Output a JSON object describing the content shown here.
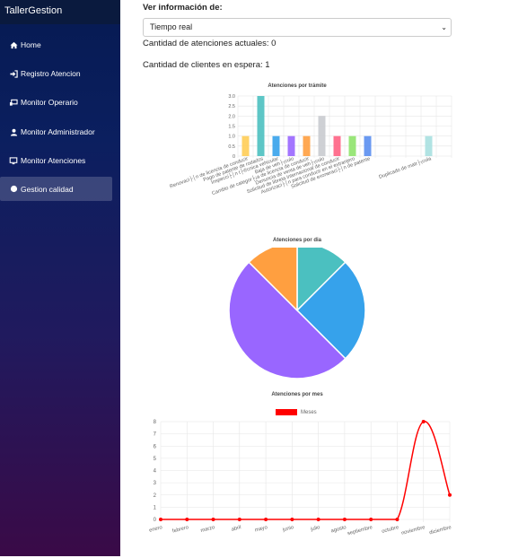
{
  "app": {
    "title": "TallerGestion"
  },
  "sidebar": {
    "items": [
      {
        "label": "Home",
        "icon": "home-icon"
      },
      {
        "label": "Registro Atencion",
        "icon": "sign-in-icon"
      },
      {
        "label": "Monitor Operario",
        "icon": "desktop-icon"
      },
      {
        "label": "Monitor Administrador",
        "icon": "user-icon"
      },
      {
        "label": "Monitor Atenciones",
        "icon": "monitor-icon"
      },
      {
        "label": "Gestion calidad",
        "icon": "circle-icon",
        "active": true
      }
    ]
  },
  "main": {
    "ver_label": "Ver información de:",
    "select_value": "Tiempo real",
    "atenciones_actuales": "Cantidad de atenciones actuales: 0",
    "clientes_espera": "Cantidad de clientes en espera: 1"
  },
  "chart_data": [
    {
      "type": "bar",
      "title": "Atenciones por trámite",
      "categories": [
        "Renovaci├│n de licencia de conducir",
        "Pago de patente de rodados",
        "Inspecci├│n t├®cnica vehicular",
        "Baja de veh├¡culo",
        "Cambio de categor├¡a de licencia de conducir",
        "Denuncia de venta de veh├¡culo",
        "Solicitud de libreta internacional de conducir",
        "Autorizaci├│n para conducir en el extranjero",
        "Solicitud de exoneraci├│n de patente",
        "Duplicado de matr├¡cula"
      ],
      "values": [
        1,
        3,
        1,
        1,
        1,
        2,
        1,
        1,
        1,
        1
      ],
      "colors": [
        "#ffcd56",
        "#4bc0c0",
        "#36a2eb",
        "#9966ff",
        "#ff9f40",
        "#c9cbcf",
        "#ff6384",
        "#8fe36b",
        "#5a8ef0",
        "#a8e0e0"
      ],
      "x_slots": [
        0.5,
        1.5,
        2.5,
        3.5,
        4.5,
        5.5,
        6.5,
        7.5,
        8.5,
        12.5
      ],
      "ylim": [
        0,
        3
      ],
      "yticks": [
        "0",
        "0.5",
        "1.0",
        "1.5",
        "2.0",
        "2.5",
        "3.0"
      ]
    },
    {
      "type": "pie",
      "title": "Atenciones por dia",
      "values": [
        1,
        2,
        4,
        1
      ],
      "colors": [
        "#4bc0c0",
        "#36a2eb",
        "#9966ff",
        "#ff9f40"
      ]
    },
    {
      "type": "line",
      "title": "Atenciones por mes",
      "series": [
        {
          "name": "Meses",
          "color": "#ff0000"
        }
      ],
      "categories": [
        "enero",
        "febrero",
        "marzo",
        "abril",
        "mayo",
        "junio",
        "julio",
        "agosto",
        "septiembre",
        "octubre",
        "noviembre",
        "diciembre"
      ],
      "values": [
        0,
        0,
        0,
        0,
        0,
        0,
        0,
        0,
        0,
        0,
        8,
        2
      ],
      "ylim": [
        0,
        8
      ],
      "yticks": [
        "0",
        "1",
        "2",
        "3",
        "4",
        "5",
        "6",
        "7",
        "8"
      ]
    }
  ]
}
